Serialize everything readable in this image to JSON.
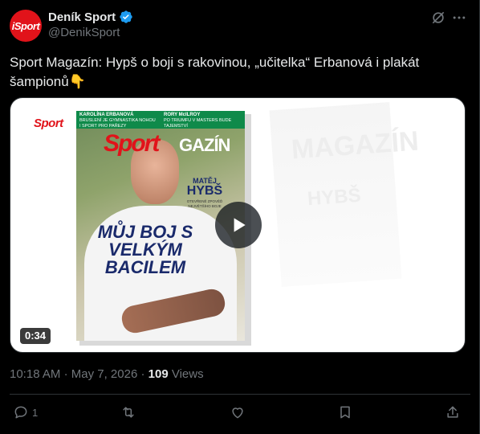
{
  "author": {
    "display_name": "Deník Sport",
    "handle": "@DenikSport",
    "avatar_text": "iSport",
    "verified": true
  },
  "tweet": {
    "text": "Sport Magazín: Hypš o boji s rakovinou, „učitelka“ Erbanová i plakát šampionů👇"
  },
  "media": {
    "type": "video",
    "duration": "0:34",
    "corner_logo": "Sport",
    "cover": {
      "top_left_name": "KAROLÍNA ERBANOVÁ",
      "top_left_sub": "BRUSLENÍ JE GYMNASTIKA NOHOU I SPORT PRO PAŘEZY",
      "top_right_name": "RORY McILROY",
      "top_right_sub": "PO TRIUMFU V MASTERS BUDE TAJEMSTVÍ",
      "logo": "Sport",
      "magazine_word": "GAZÍN",
      "feature_first_name": "MATĚJ",
      "feature_last_name": "HYBŠ",
      "feature_sub": "OTEVŘENĚ ZPOVĚĎ NEJVĚTŠÍHO BOJE",
      "headline": "MŮJ BOJ S VELKÝM BACILEM"
    }
  },
  "meta": {
    "time": "10:18 AM",
    "separator": "·",
    "date": "May 7, 2026",
    "views_count": "109",
    "views_label": "Views"
  },
  "actions": {
    "reply_count": "1",
    "retweet_count": "",
    "like_count": ""
  },
  "colors": {
    "background": "#000000",
    "text": "#e7e9ea",
    "secondary": "#71767b",
    "verified": "#1d9bf0",
    "brand_red": "#e1131a"
  }
}
